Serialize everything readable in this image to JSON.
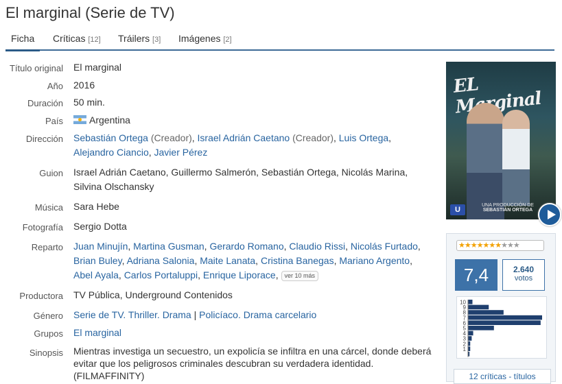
{
  "title": "El marginal (Serie de TV)",
  "tabs": [
    {
      "label": "Ficha",
      "count": ""
    },
    {
      "label": "Críticas",
      "count": "[12]"
    },
    {
      "label": "Tráilers",
      "count": "[3]"
    },
    {
      "label": "Imágenes",
      "count": "[2]"
    }
  ],
  "fields": {
    "titulo_original": {
      "label": "Título original",
      "value": "El marginal"
    },
    "anio": {
      "label": "Año",
      "value": "2016"
    },
    "duracion": {
      "label": "Duración",
      "value": "50 min."
    },
    "pais": {
      "label": "País",
      "value": "Argentina"
    },
    "direccion": {
      "label": "Dirección",
      "people": [
        {
          "name": "Sebastián Ortega",
          "role": "(Creador)"
        },
        {
          "name": "Israel Adrián Caetano",
          "role": "(Creador)"
        },
        {
          "name": "Luis Ortega",
          "role": ""
        },
        {
          "name": "Alejandro Ciancio",
          "role": ""
        },
        {
          "name": "Javier Pérez",
          "role": ""
        }
      ]
    },
    "guion": {
      "label": "Guion",
      "line1": "Israel Adrián Caetano, Guillermo Salmerón, Sebastián Ortega, Nicolás Marina,",
      "line2": "Silvina Olschansky"
    },
    "musica": {
      "label": "Música",
      "value": "Sara Hebe"
    },
    "fotografia": {
      "label": "Fotografía",
      "value": "Sergio Dotta"
    },
    "reparto": {
      "label": "Reparto",
      "names": [
        "Juan Minujín",
        "Martina Gusman",
        "Gerardo Romano",
        "Claudio Rissi",
        "Nicolás Furtado",
        "Brian Buley",
        "Adriana Salonia",
        "Maite Lanata",
        "Cristina Banegas",
        "Mariano Argento",
        "Abel Ayala",
        "Carlos Portaluppi",
        "Enrique Liporace"
      ],
      "more": "ver 10 más"
    },
    "productora": {
      "label": "Productora",
      "value": "TV Pública, Underground Contenidos"
    },
    "genero": {
      "label": "Género",
      "part1": "Serie de TV. Thriller. Drama",
      "sep": "|",
      "part2": "Policíaco. Drama carcelario"
    },
    "grupos": {
      "label": "Grupos",
      "value": "El marginal"
    },
    "sinopsis": {
      "label": "Sinopsis",
      "value": "Mientras investiga un secuestro, un expolicía se infiltra en una cárcel, donde deberá evitar que los peligrosos criminales descubran su verdadera identidad. (FILMAFFINITY)"
    }
  },
  "poster": {
    "title": "EL Marginal",
    "caption1": "UNA PRODUCCIÓN DE",
    "caption2": "SEBASTIÁN ORTEGA",
    "logo": "U"
  },
  "rating": {
    "stars_filled": 7.4,
    "stars_total": 10,
    "score": "7,4",
    "votes": "2.640",
    "votes_label": "votos",
    "histogram": {
      "labels": [
        "10",
        "9",
        "8",
        "7",
        "6",
        "5",
        "4",
        "3",
        "2",
        "1"
      ],
      "values": [
        0.06,
        0.28,
        0.48,
        1.0,
        0.98,
        0.35,
        0.07,
        0.05,
        0.03,
        0.03,
        0.02
      ]
    },
    "critics_link": "12 críticas - títulos"
  }
}
